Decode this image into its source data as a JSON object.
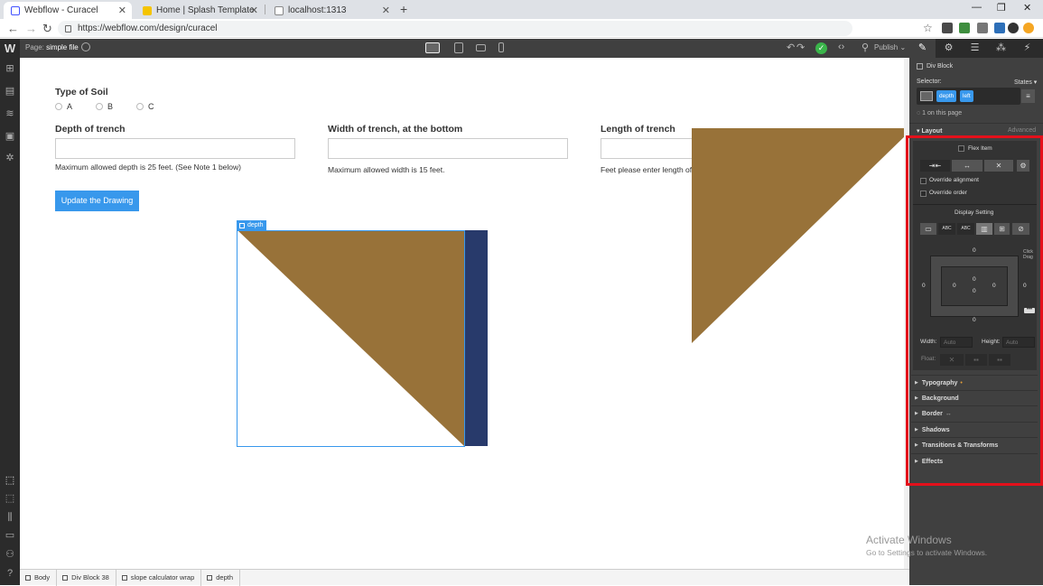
{
  "browser": {
    "tabs": [
      {
        "title": "Webflow - Curacel",
        "active": true
      },
      {
        "title": "Home | Splash Template",
        "active": false
      },
      {
        "title": "localhost:1313",
        "active": false
      }
    ],
    "url": "https://webflow.com/design/curacel",
    "new_tab": "+",
    "window_controls": [
      "—",
      "❐",
      "✕"
    ]
  },
  "designer": {
    "logo": "W",
    "page_prefix": "Page:",
    "page_name": "simple file",
    "publish_label": "Publish",
    "left_toolbar_icons": [
      "add-icon",
      "pages-icon",
      "cms-icon",
      "assets-icon",
      "settings-icon"
    ],
    "left_toolbar_bottom_icons": [
      "select-icon",
      "preview-icon",
      "grid-icon",
      "layers-icon",
      "team-icon",
      "help-icon"
    ]
  },
  "form": {
    "soil_label": "Type of Soil",
    "soil_options": [
      "A",
      "B",
      "C"
    ],
    "depth_label": "Depth of trench",
    "depth_note": "Maximum allowed depth is 25 feet. (See Note 1 below)",
    "width_label": "Width of trench, at the bottom",
    "width_note": "Maximum allowed width is 15 feet.",
    "length_label": "Length of trench",
    "length_note": "Feet please enter length of",
    "update_button": "Update the Drawing",
    "selected_tag": "depth"
  },
  "colors": {
    "soil": "#987239",
    "trench_wall": "#283a6b",
    "selection": "#3898ec",
    "highlight": "#e4101b"
  },
  "breadcrumbs": [
    "Body",
    "Div Block 38",
    "slope calculator wrap",
    "depth"
  ],
  "panel": {
    "element_type": "Div Block",
    "selector_label": "Selector:",
    "states_label": "States",
    "classes": [
      "depth",
      "left"
    ],
    "on_page": "1 on this page",
    "layout_label": "Layout",
    "advanced_label": "Advanced",
    "flex_item_label": "Flex Item",
    "override_alignment": "Override alignment",
    "override_order": "Override order",
    "display_setting": "Display Setting",
    "display_text_1": "ABC",
    "display_text_2": "ABC",
    "drag_hint": "Click Drag",
    "margin_values": [
      "0",
      "0",
      "0",
      "0"
    ],
    "padding_values": [
      "0",
      "0",
      "0",
      "0"
    ],
    "width_label": "Width:",
    "width_value": "Auto",
    "height_label": "Height:",
    "height_value": "Auto",
    "float_label": "Float:",
    "sections": [
      {
        "label": "Typography",
        "mark": "•"
      },
      {
        "label": "Background",
        "mark": ""
      },
      {
        "label": "Border",
        "mark": "↔"
      },
      {
        "label": "Shadows",
        "mark": ""
      },
      {
        "label": "Transitions & Transforms",
        "mark": ""
      },
      {
        "label": "Effects",
        "mark": ""
      }
    ]
  },
  "watermark": {
    "title": "Activate Windows",
    "subtitle": "Go to Settings to activate Windows."
  }
}
